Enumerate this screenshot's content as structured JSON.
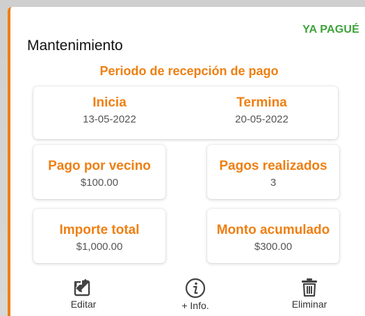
{
  "card": {
    "title": "Mantenimiento",
    "status": "YA PAGUÉ",
    "accent_color": "#ef7f12",
    "status_color": "#3fa23c"
  },
  "period": {
    "title": "Periodo de recepción de pago",
    "start_label": "Inicia",
    "start_value": "13-05-2022",
    "end_label": "Termina",
    "end_value": "20-05-2022"
  },
  "stats": {
    "per_neighbor_label": "Pago por vecino",
    "per_neighbor_value": "$100.00",
    "payments_label": "Pagos realizados",
    "payments_value": "3",
    "total_label": "Importe total",
    "total_value": "$1,000.00",
    "accumulated_label": "Monto acumulado",
    "accumulated_value": "$300.00"
  },
  "actions": {
    "edit_label": "Editar",
    "edit_icon": "edit-icon",
    "info_label": "+ Info.",
    "info_icon": "info-icon",
    "delete_label": "Eliminar",
    "delete_icon": "trash-icon"
  }
}
